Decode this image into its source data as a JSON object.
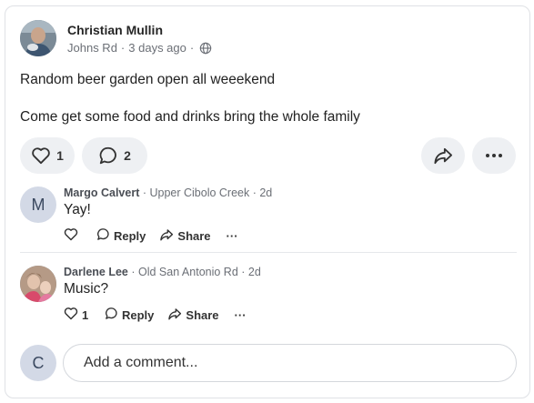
{
  "post": {
    "author": "Christian Mullin",
    "location": "Johns Rd",
    "time": "3 days ago",
    "separator": "·",
    "body": [
      "Random beer garden open all weeekend",
      "Come get some food and drinks bring the whole family"
    ],
    "like_count": "1",
    "comment_count": "2",
    "icons": [
      "globe-icon",
      "heart-icon",
      "comment-icon",
      "share-icon",
      "more-icon"
    ]
  },
  "comments": [
    {
      "initial": "M",
      "name": "Margo Calvert",
      "meta": " · Upper Cibolo Creek · 2d",
      "text": "Yay!",
      "like_count": "",
      "reply_label": "Reply",
      "share_label": "Share",
      "more_label": "···"
    },
    {
      "initial": "",
      "name": "Darlene Lee",
      "meta": " · Old San Antonio Rd · 2d",
      "text": "Music?",
      "like_count": "1",
      "reply_label": "Reply",
      "share_label": "Share",
      "more_label": "···"
    }
  ],
  "composer": {
    "avatar_initial": "C",
    "placeholder": "Add a comment..."
  },
  "colors": {
    "pill_bg": "#eef0f3",
    "avatar_letter_bg": "#d3d9e6",
    "border": "#dfe1e5"
  }
}
